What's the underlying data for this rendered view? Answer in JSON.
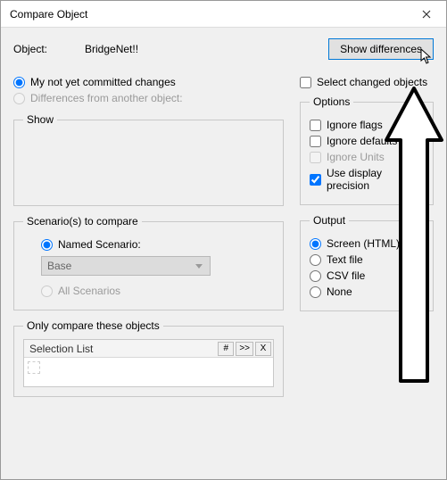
{
  "window": {
    "title": "Compare Object"
  },
  "header": {
    "object_label": "Object:",
    "object_name": "BridgeNet!!",
    "show_diff_btn": "Show differences"
  },
  "left": {
    "opt_my_changes": "My not yet committed changes",
    "opt_diff_other": "Differences from another object:",
    "show_legend": "Show",
    "scenarios_legend": "Scenario(s) to compare",
    "named_scenario": "Named Scenario:",
    "scenario_value": "Base",
    "all_scenarios": "All Scenarios",
    "only_legend": "Only compare these objects",
    "selection_list_title": "Selection List",
    "btn_hash": "#",
    "btn_next": ">>",
    "btn_x": "X"
  },
  "right": {
    "select_changed": "Select changed objects",
    "options_legend": "Options",
    "ignore_flags": "Ignore flags",
    "ignore_defaults": "Ignore defaults",
    "ignore_units": "Ignore Units",
    "use_display": "Use display precision",
    "output_legend": "Output",
    "screen": "Screen (HTML)",
    "textfile": "Text file",
    "csvfile": "CSV file",
    "none": "None"
  }
}
